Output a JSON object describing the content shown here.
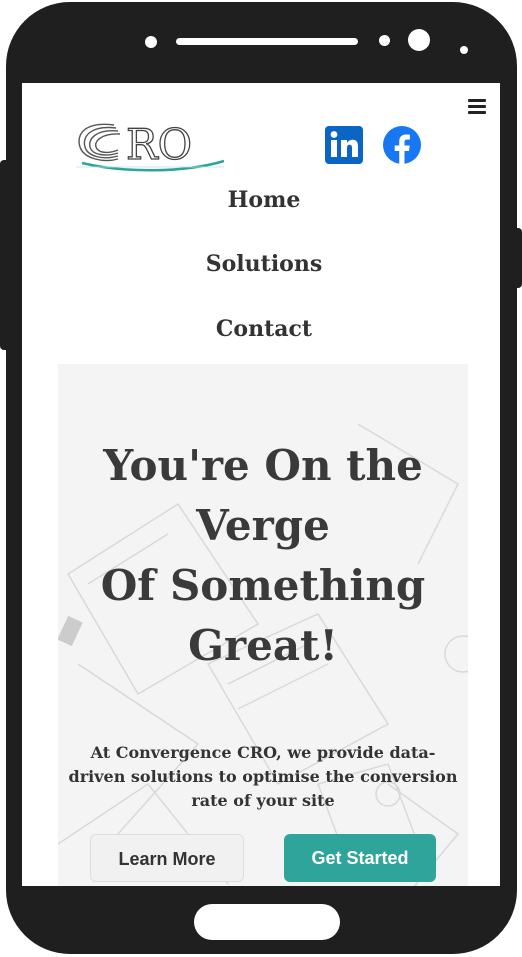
{
  "header": {
    "logo_text": "CRO",
    "menu_icon": "hamburger-menu-icon",
    "social": [
      {
        "name": "linkedin-icon",
        "color": "#0a66c2"
      },
      {
        "name": "facebook-icon",
        "color": "#1877f2"
      }
    ]
  },
  "nav": {
    "items": [
      {
        "label": "Home"
      },
      {
        "label": "Solutions"
      },
      {
        "label": "Contact"
      }
    ]
  },
  "hero": {
    "title_lines": [
      "You're On the",
      "Verge",
      "Of Something",
      "Great!"
    ],
    "text_lines": [
      "At Convergence CRO, we provide data-",
      "driven solutions to optimise the conversion",
      "rate of your site"
    ],
    "learn_more_label": "Learn More",
    "get_started_label": "Get Started",
    "accent_color": "#2fa49a"
  }
}
